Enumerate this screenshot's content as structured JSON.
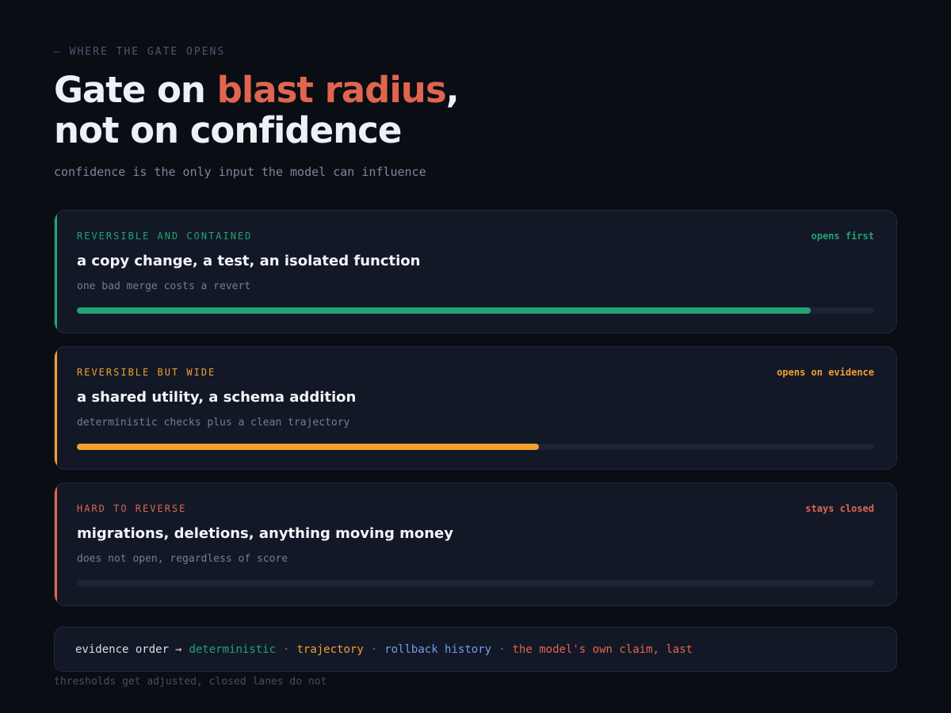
{
  "header": {
    "eyebrow": "— WHERE THE GATE OPENS",
    "headline_part1": "Gate on ",
    "headline_accent": "blast radius",
    "headline_part2": ",",
    "headline_line2": "not on confidence",
    "subtitle": "confidence is the only input the model can influence"
  },
  "colors": {
    "green": "#22a374",
    "amber": "#f0a12c",
    "red": "#e0654f",
    "blue": "#7897ef"
  },
  "lanes": [
    {
      "label": "REVERSIBLE AND CONTAINED",
      "status": "opens first",
      "title": "a copy change, a test, an isolated function",
      "description": "one bad merge costs a revert",
      "progress": 0.92,
      "color": "#22a374"
    },
    {
      "label": "REVERSIBLE BUT WIDE",
      "status": "opens on evidence",
      "title": "a shared utility, a schema addition",
      "description": "deterministic checks plus a clean trajectory",
      "progress": 0.58,
      "color": "#f0a12c"
    },
    {
      "label": "HARD TO REVERSE",
      "status": "stays closed",
      "title": "migrations, deletions, anything moving money",
      "description": "does not open, regardless of score",
      "progress": 0,
      "color": "#e0654f"
    }
  ],
  "evidence": {
    "lead": "evidence order",
    "arrow": "→",
    "separator": "·",
    "items": [
      {
        "text": "deterministic",
        "color": "#22a374"
      },
      {
        "text": "trajectory",
        "color": "#f0a12c"
      },
      {
        "text": "rollback history",
        "color": "#7897ef"
      },
      {
        "text": "the model's own claim, last",
        "color": "#e0654f"
      }
    ]
  },
  "footnote": "thresholds get adjusted, closed lanes do not"
}
